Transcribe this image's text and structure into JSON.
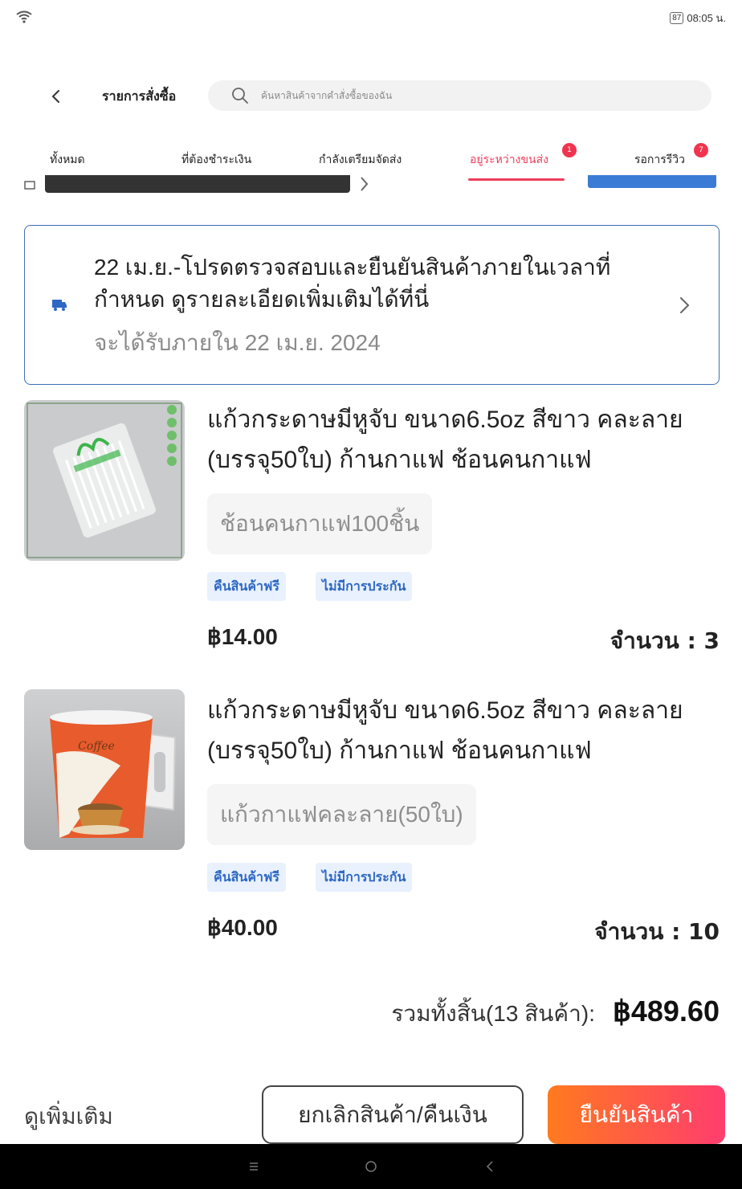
{
  "status_bar": {
    "battery": "87",
    "time": "08:05 น."
  },
  "header": {
    "title": "รายการสั่งซื้อ",
    "search_placeholder": "ค้นหาสินค้าจากคำสั่งซื้อของฉัน"
  },
  "tabs": [
    {
      "label": "ทั้งหมด"
    },
    {
      "label": "ที่ต้องชำระเงิน"
    },
    {
      "label": "กำลังเตรียมจัดส่ง"
    },
    {
      "label": "อยู่ระหว่างขนส่ง",
      "badge": "1",
      "active": true
    },
    {
      "label": "รอการรีวิว",
      "badge": "7"
    }
  ],
  "notice": {
    "line1": "22 เม.ย.-โปรดตรวจสอบและยืนยันสินค้าภายในเวลาที่",
    "line2": "กำหนด ดูรายละเอียดเพิ่มเติมได้ที่นี่",
    "eta": "จะได้รับภายใน 22 เม.ย. 2024"
  },
  "products": [
    {
      "title_line1": "แก้วกระดาษมีหูจับ ขนาด6.5oz สีขาว คละลาย",
      "title_line2": "(บรรจุ50ใบ) ก้านกาแฟ ช้อนคนกาแฟ",
      "variant": "ช้อนคนกาแฟ100ชิ้น",
      "tags": [
        "คืนสินค้าฟรี",
        "ไม่มีการประกัน"
      ],
      "price": "฿14.00",
      "quantity": "จำนวน : 3"
    },
    {
      "title_line1": "แก้วกระดาษมีหูจับ ขนาด6.5oz สีขาว คละลาย",
      "title_line2": "(บรรจุ50ใบ) ก้านกาแฟ ช้อนคนกาแฟ",
      "variant": "แก้วกาแฟคละลาย(50ใบ)",
      "tags": [
        "คืนสินค้าฟรี",
        "ไม่มีการประกัน"
      ],
      "price": "฿40.00",
      "quantity": "จำนวน : 10",
      "cup_text": "Coffee"
    }
  ],
  "total": {
    "label": "รวมทั้งสิ้น(13 สินค้า):",
    "value": "฿489.60"
  },
  "actions": {
    "more": "ดูเพิ่มเติม",
    "cancel": "ยกเลิกสินค้า/คืนเงิน",
    "confirm": "ยืนยันสินค้า"
  },
  "colors": {
    "accent": "#ee3e5b",
    "tag_text": "#2d68c4",
    "confirm_gradient_start": "#ff7a1e",
    "confirm_gradient_end": "#ff3d6e"
  }
}
